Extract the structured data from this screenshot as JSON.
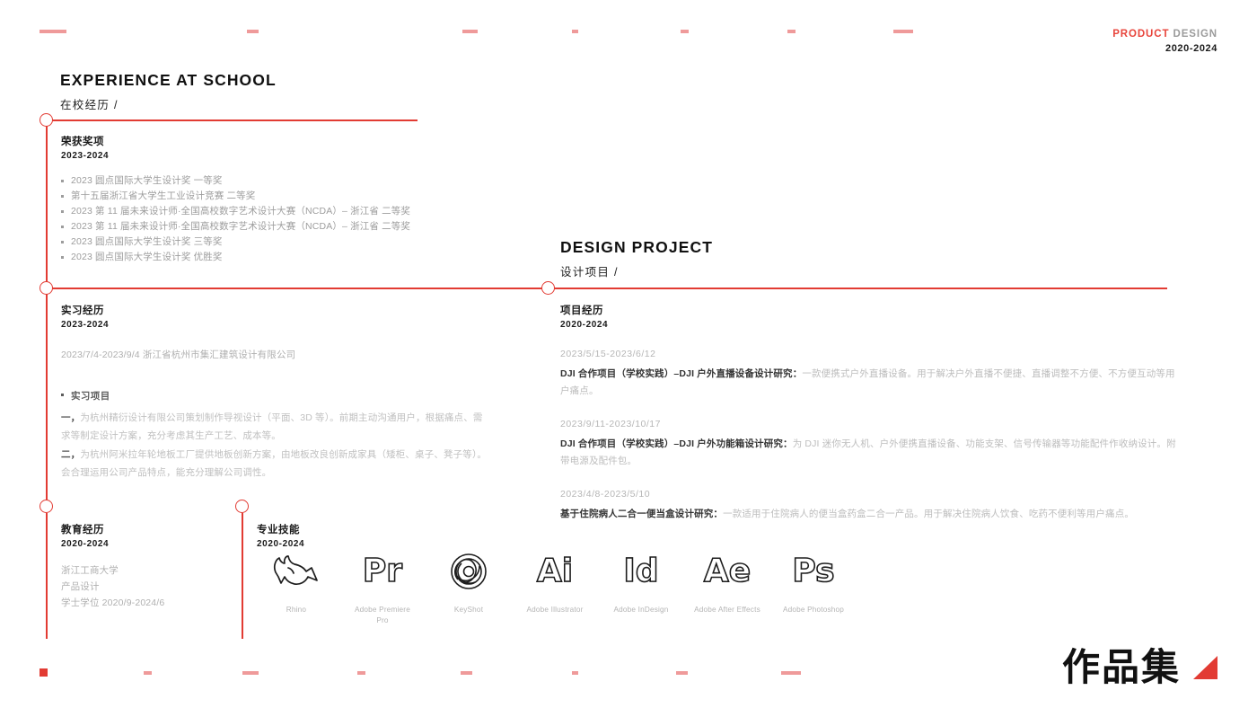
{
  "header": {
    "brand_primary": "PRODUCT",
    "brand_secondary": "DESIGN",
    "years": "2020-2024"
  },
  "colors": {
    "accent_red": "#e23b33",
    "light_red": "#ef9a9a",
    "body_grey": "#b0b0b0",
    "heading_black": "#1a1a1a"
  },
  "sections": {
    "experience": {
      "title_en": "EXPERIENCE AT SCHOOL",
      "title_cn": "在校经历 /"
    },
    "design_project": {
      "title_en": "DESIGN PROJECT",
      "title_cn": "设计项目 /"
    }
  },
  "awards": {
    "title": "荣获奖项",
    "years": "2023-2024",
    "items": [
      "2023 圆点国际大学生设计奖 一等奖",
      "第十五届浙江省大学生工业设计竞赛 二等奖",
      "2023 第 11 届未来设计师·全国高校数字艺术设计大赛（NCDA）– 浙江省 二等奖",
      "2023 第 11 届未来设计师·全国高校数字艺术设计大赛（NCDA）– 浙江省 二等奖",
      "2023 圆点国际大学生设计奖 三等奖",
      "2023 圆点国际大学生设计奖 优胜奖"
    ]
  },
  "internship": {
    "title": "实习经历",
    "years": "2023-2024",
    "company_line": "2023/7/4-2023/9/4 浙江省杭州市集汇建筑设计有限公司",
    "sub_head": "实习项目",
    "paragraphs": [
      {
        "lead": "一，",
        "text": "为杭州精衍设计有限公司策划制作导视设计（平面、3D 等）。前期主动沟通用户，根据痛点、需求等制定设计方案，充分考虑其生产工艺、成本等。"
      },
      {
        "lead": "二，",
        "text": "为杭州阿米拉年轮地板工厂提供地板创新方案，由地板改良创新成家具（矮柜、桌子、凳子等）。会合理运用公司产品特点，能充分理解公司调性。"
      }
    ]
  },
  "projects": {
    "title": "项目经历",
    "years": "2020-2024",
    "items": [
      {
        "date": "2023/5/15-2023/6/12",
        "name": "DJI 合作项目（学校实践）–DJI 户外直播设备设计研究：",
        "desc": "一款便携式户外直播设备。用于解决户外直播不便捷、直播调整不方便、不方便互动等用户痛点。"
      },
      {
        "date": "2023/9/11-2023/10/17",
        "name": "DJI 合作项目（学校实践）–DJI 户外功能箱设计研究：",
        "desc": "为 DJI 迷你无人机、户外便携直播设备、功能支架、信号传输器等功能配件作收纳设计。附带电源及配件包。"
      },
      {
        "date": "2023/4/8-2023/5/10",
        "name": "基于住院病人二合一便当盒设计研究：",
        "desc": "一款适用于住院病人的便当盒药盒二合一产品。用于解决住院病人饮食、吃药不便利等用户痛点。"
      }
    ]
  },
  "education": {
    "title": "教育经历",
    "years": "2020-2024",
    "lines": [
      "浙江工商大学",
      "产品设计",
      "学士学位 2020/9-2024/6"
    ]
  },
  "skills": {
    "title": "专业技能",
    "years": "2020-2024",
    "items": [
      {
        "icon": "rhino-icon",
        "glyph": "",
        "label": "Rhino"
      },
      {
        "icon": "adobe-premiere-pro-icon",
        "glyph": "Pr",
        "label": "Adobe Premiere Pro"
      },
      {
        "icon": "keyshot-icon",
        "glyph": "",
        "label": "KeyShot"
      },
      {
        "icon": "adobe-illustrator-icon",
        "glyph": "Ai",
        "label": "Adobe Illustrator"
      },
      {
        "icon": "adobe-indesign-icon",
        "glyph": "Id",
        "label": "Adobe InDesign"
      },
      {
        "icon": "adobe-after-effects-icon",
        "glyph": "Ae",
        "label": "Adobe After Effects"
      },
      {
        "icon": "adobe-photoshop-icon",
        "glyph": "Ps",
        "label": "Adobe Photoshop"
      }
    ]
  },
  "footer": {
    "label": "作品集"
  }
}
